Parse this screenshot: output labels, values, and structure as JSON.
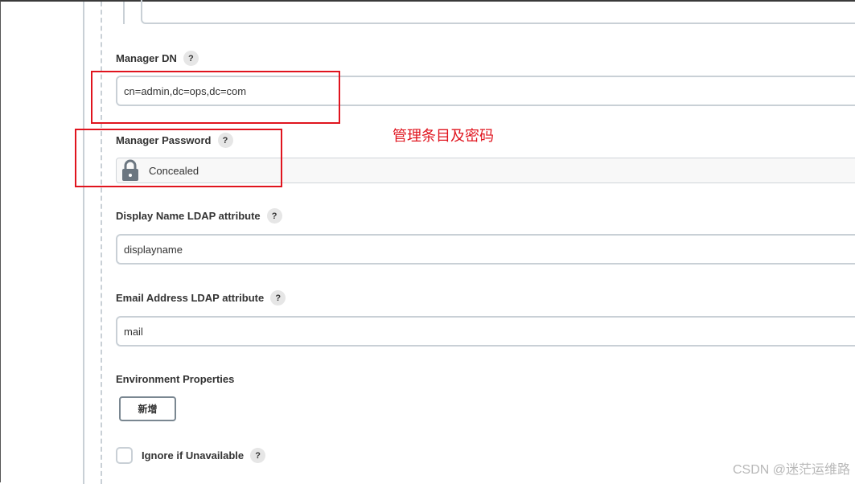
{
  "fields": {
    "manager_dn": {
      "label": "Manager DN",
      "value": "cn=admin,dc=ops,dc=com"
    },
    "manager_password": {
      "label": "Manager Password",
      "value": "Concealed"
    },
    "display_name": {
      "label": "Display Name LDAP attribute",
      "value": "displayname"
    },
    "email": {
      "label": "Email Address LDAP attribute",
      "value": "mail"
    },
    "env_props": {
      "label": "Environment Properties",
      "add_button": "新增"
    },
    "ignore": {
      "label": "Ignore if Unavailable",
      "checked": false
    }
  },
  "help_glyph": "?",
  "annotation": {
    "text": "管理条目及密码",
    "color": "#e0141e"
  },
  "watermark": "CSDN @迷茫运维路"
}
